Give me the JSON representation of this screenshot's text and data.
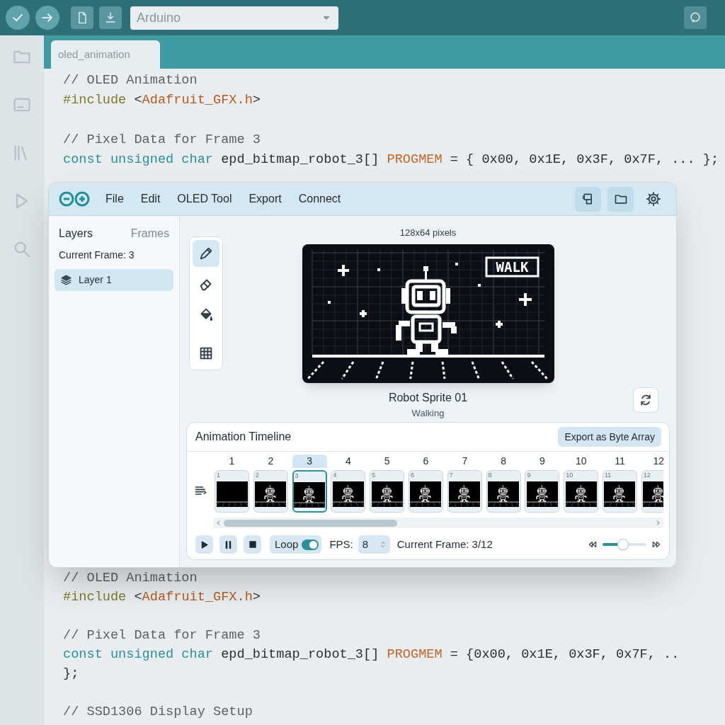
{
  "toolbar": {
    "board_selector": "Arduino"
  },
  "editor_tab": {
    "label": "oled_animation"
  },
  "code_top": [
    [
      {
        "tokens": [
          {
            "kind": "comment",
            "text": "// OLED Animation"
          }
        ]
      },
      {
        "tokens": [
          {
            "kind": "directive",
            "text": "#include"
          },
          {
            "kind": "plain",
            "text": " <"
          },
          {
            "kind": "header",
            "text": "Adafruit_GFX.h"
          },
          {
            "kind": "plain",
            "text": ">"
          }
        ]
      }
    ],
    [
      {
        "tokens": [
          {
            "kind": "comment",
            "text": "// Pixel Data for Frame 3"
          }
        ]
      },
      {
        "tokens": [
          {
            "kind": "keyword",
            "text": "const unsigned char"
          },
          {
            "kind": "plain",
            "text": " epd_bitmap_robot_3[] "
          },
          {
            "kind": "macro",
            "text": "PROGMEM"
          },
          {
            "kind": "plain",
            "text": " = { 0x00, 0x1E, 0x3F, 0x7F, ... };"
          }
        ]
      }
    ]
  ],
  "code_bottom": [
    [
      {
        "tokens": [
          {
            "kind": "comment",
            "text": "// OLED Animation"
          }
        ]
      },
      {
        "tokens": [
          {
            "kind": "directive",
            "text": "#include"
          },
          {
            "kind": "plain",
            "text": " <"
          },
          {
            "kind": "header",
            "text": "Adafruit_GFX.h"
          },
          {
            "kind": "plain",
            "text": ">"
          }
        ]
      }
    ],
    [
      {
        "tokens": [
          {
            "kind": "comment",
            "text": "// Pixel Data for Frame 3"
          }
        ]
      },
      {
        "tokens": [
          {
            "kind": "keyword",
            "text": "const unsigned char"
          },
          {
            "kind": "plain",
            "text": " epd_bitmap_robot_3[] "
          },
          {
            "kind": "macro",
            "text": "PROGMEM"
          },
          {
            "kind": "plain",
            "text": " = {0x00, 0x1E, 0x3F, 0x7F, .."
          }
        ]
      },
      {
        "tokens": [
          {
            "kind": "plain",
            "text": "};"
          }
        ]
      }
    ],
    [
      {
        "tokens": [
          {
            "kind": "comment",
            "text": "// SSD1306 Display Setup"
          }
        ]
      }
    ]
  ],
  "panel": {
    "menu": [
      "File",
      "Edit",
      "OLED Tool",
      "Export",
      "Connect"
    ],
    "sidebar": {
      "tabs": [
        {
          "label": "Layers",
          "selected": true
        },
        {
          "label": "Frames",
          "selected": false
        }
      ],
      "current_frame": "Current Frame: 3",
      "layers": [
        {
          "name": "Layer 1",
          "selected": true
        }
      ]
    },
    "tools": [
      {
        "kind": "pencil",
        "selected": true
      },
      {
        "kind": "eraser",
        "selected": false
      },
      {
        "kind": "fill",
        "selected": false
      },
      {
        "kind": "grid",
        "selected": false
      }
    ],
    "canvas": {
      "size_label": "128x64 pixels",
      "sign": "WALK",
      "title": "Robot Sprite 01",
      "subtitle": "Walking"
    },
    "timeline": {
      "title": "Animation Timeline",
      "export_button": "Export as Byte Array",
      "frames": [
        {
          "number": "1",
          "label": "1",
          "selected": false,
          "empty": true
        },
        {
          "number": "2",
          "label": "2",
          "selected": false,
          "empty": false
        },
        {
          "number": "3",
          "label": "3",
          "selected": true,
          "empty": false
        },
        {
          "number": "4",
          "label": "4",
          "selected": false,
          "empty": false
        },
        {
          "number": "5",
          "label": "5",
          "selected": false,
          "empty": false
        },
        {
          "number": "6",
          "label": "6",
          "selected": false,
          "empty": false
        },
        {
          "number": "7",
          "label": "7",
          "selected": false,
          "empty": false
        },
        {
          "number": "8",
          "label": "8",
          "selected": false,
          "empty": false
        },
        {
          "number": "9",
          "label": "9",
          "selected": false,
          "empty": false
        },
        {
          "number": "10",
          "label": "10",
          "selected": false,
          "empty": false
        },
        {
          "number": "11",
          "label": "11",
          "selected": false,
          "empty": false
        },
        {
          "number": "12",
          "label": "12",
          "selected": false,
          "empty": false
        }
      ],
      "loop": {
        "label": "Loop",
        "on": true
      },
      "fps": {
        "label": "FPS:",
        "value": "8"
      },
      "current_frame": "Current Frame: 3/12",
      "speed": {
        "level": 0.47
      }
    }
  }
}
